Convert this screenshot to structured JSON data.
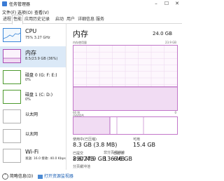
{
  "window": {
    "title": "任务管理器",
    "buttons": [
      "–",
      "☐",
      "✕"
    ]
  },
  "menu": [
    "文件(F)",
    "选项(O)",
    "查看(V)"
  ],
  "tabs": [
    "进程",
    "性能",
    "应用历史记录",
    "启动",
    "用户",
    "详细信息",
    "服务"
  ],
  "active_tab": "性能",
  "sidebar": [
    {
      "name": "CPU",
      "detail": "75%  3.27 GHz",
      "color": "#3b87d9"
    },
    {
      "name": "内存",
      "detail": "8.5/23.9 GB (36%)",
      "color": "#a74ab3",
      "selected": true
    },
    {
      "name": "磁盘 0 (G: F: E:)",
      "detail": "0%",
      "color": "#4e9a2f"
    },
    {
      "name": "磁盘 1 (C: D:)",
      "detail": "0%",
      "color": "#4e9a2f"
    },
    {
      "name": "以太网",
      "detail": "",
      "color": "#b0b0b0"
    },
    {
      "name": "以太网",
      "detail": "",
      "color": "#b0b0b0"
    },
    {
      "name": "Wi-Fi",
      "detail": "发送: 16.0  接收: 40.0 Kbps",
      "color": "#b0b0b0"
    }
  ],
  "main": {
    "title": "内存",
    "total": "24.0 GB",
    "usage_label": "内存使用量",
    "usage_max": "23.9 GB",
    "time_label": "60 秒",
    "composition_label": "内存组合",
    "usage_fraction": 0.36,
    "stats": [
      {
        "label": "使用中(已压缩)",
        "value": "8.3 GB (3.8 MB)"
      },
      {
        "label": "可用",
        "value": "15.4 GB"
      },
      {
        "label": "已提交",
        "value": "8.6/27.9 GB"
      },
      {
        "label": "已缓存",
        "value": "6.6 GB"
      },
      {
        "label": "分页缓冲池",
        "value": "290 MB"
      },
      {
        "label": "非分页缓冲池",
        "value": "136 MB"
      }
    ],
    "accent": "#a74ab3"
  },
  "status": {
    "fewer_details": "简略信息(D)",
    "open_monitor": "打开资源监视器"
  }
}
